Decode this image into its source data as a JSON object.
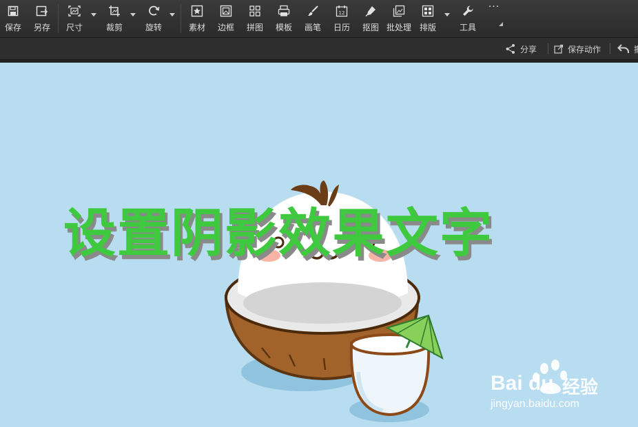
{
  "toolbar": {
    "items": [
      {
        "label": "保存",
        "icon": "save-icon"
      },
      {
        "label": "另存",
        "icon": "save-as-icon"
      },
      {
        "label": "尺寸",
        "icon": "resize-icon"
      },
      {
        "label": "裁剪",
        "icon": "crop-icon"
      },
      {
        "label": "旋转",
        "icon": "rotate-icon"
      },
      {
        "label": "素材",
        "icon": "material-icon"
      },
      {
        "label": "边框",
        "icon": "border-icon"
      },
      {
        "label": "拼图",
        "icon": "collage-icon"
      },
      {
        "label": "模板",
        "icon": "template-icon"
      },
      {
        "label": "画笔",
        "icon": "brush-icon"
      },
      {
        "label": "日历",
        "icon": "calendar-icon"
      },
      {
        "label": "抠图",
        "icon": "cutout-icon"
      },
      {
        "label": "批处理",
        "icon": "batch-icon"
      },
      {
        "label": "排版",
        "icon": "layout-icon"
      },
      {
        "label": "工具",
        "icon": "wrench-icon"
      }
    ],
    "more_label": "···",
    "calendar_day": "12"
  },
  "subbar": {
    "share_label": "分享",
    "save_action_label": "保存动作",
    "undo_label": "撤"
  },
  "canvas": {
    "overlay_text": "设置阴影效果文字",
    "background_color": "#b8dcf0",
    "text_color": "#3ec93e"
  },
  "watermark": {
    "brand": "Bai du",
    "brand_cn": "经验",
    "url": "jingyan.baidu.com"
  }
}
